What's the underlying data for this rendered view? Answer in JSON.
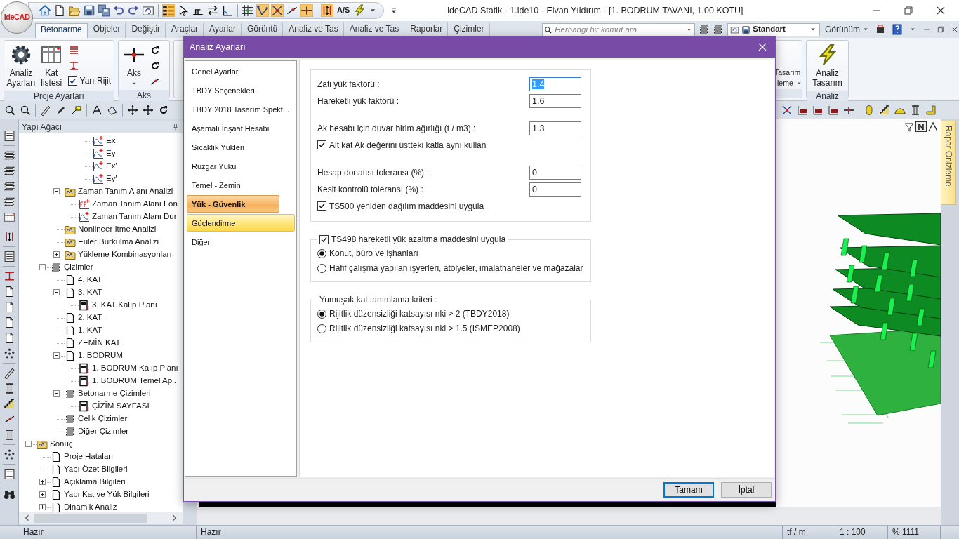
{
  "app": {
    "logo": "ideCAD",
    "title": "ideCAD Statik - 1.ide10 - Elvan Yıldırım - [1. BODRUM TAVANI,  1.00 KOTU]"
  },
  "quick_access": [
    {
      "kind": "tool",
      "on": false
    },
    {
      "kind": "tool",
      "on": false
    },
    {
      "kind": "tool",
      "on": false
    },
    {
      "kind": "tool",
      "on": false
    },
    {
      "kind": "tool",
      "on": false
    },
    {
      "kind": "tool",
      "on": false
    },
    {
      "kind": "tool",
      "on": false
    },
    {
      "kind": "tool",
      "on": false
    },
    {
      "kind": "tool",
      "on": true
    },
    {
      "kind": "tool",
      "on": false
    },
    {
      "kind": "tool",
      "on": false
    },
    {
      "kind": "tool",
      "on": false
    },
    {
      "kind": "tool",
      "on": false
    },
    {
      "kind": "tool",
      "on": false
    },
    {
      "kind": "tool",
      "on": true
    },
    {
      "kind": "tool",
      "on": true
    },
    {
      "kind": "tool",
      "on": false
    },
    {
      "kind": "tool",
      "on": true
    },
    {
      "kind": "tool",
      "on": true
    },
    {
      "kind": "text",
      "label": "A/S"
    },
    {
      "kind": "tool",
      "on": false
    },
    {
      "kind": "menu"
    }
  ],
  "ribbon_tabs": [
    {
      "label": "Betonarme",
      "selected": true
    },
    {
      "label": "Objeler",
      "selected": false
    },
    {
      "label": "Değiştir",
      "selected": false
    },
    {
      "label": "Araçlar",
      "selected": false
    },
    {
      "label": "Ayarlar",
      "selected": false
    },
    {
      "label": "Görüntü",
      "selected": false
    },
    {
      "label": "Analiz ve Tas",
      "selected": false
    },
    {
      "label": "Analiz ve Tas",
      "selected": false
    },
    {
      "label": "Raporlar",
      "selected": false
    },
    {
      "label": "Çizimler",
      "selected": false
    }
  ],
  "command_search": {
    "placeholder": "Herhangi bir komut ara"
  },
  "style_select": {
    "value": "Standart"
  },
  "view_menu": {
    "label": "Görünüm"
  },
  "ribbon": {
    "project_group": {
      "label": "Proje Ayarları",
      "settings_button": "Analiz Ayarları",
      "floors_button": "Kat listesi",
      "semi_rigid": {
        "label": "Yarı Rijit",
        "checked": true
      }
    },
    "axis_group": {
      "label": "Aks",
      "axis_button": "Aks"
    },
    "design_group": {
      "lines": [
        "Tasarım",
        "leme"
      ]
    },
    "analysis_group": {
      "label": "Analiz",
      "button": "Analiz Tasarım"
    }
  },
  "tree": {
    "title": "Yapı Ağacı",
    "nodes": [
      {
        "children": [
          {
            "children": [
              {
                "children": [
                  {
                    "children": [
                      {
                        "label": "Ex",
                        "kind": "chart"
                      },
                      {
                        "label": "Ey",
                        "kind": "chart"
                      },
                      {
                        "label": "Ex'",
                        "kind": "chart"
                      },
                      {
                        "label": "Ey'",
                        "kind": "chart"
                      }
                    ]
                  }
                ]
              },
              {
                "label": "Zaman Tanım Alanı Analizi",
                "kind": "folder",
                "expanded": true,
                "children": [
                  {
                    "label": "Zaman Tanım Alanı Fon",
                    "kind": "function"
                  },
                  {
                    "label": "Zaman Tanım Alanı Dur",
                    "kind": "chart"
                  }
                ]
              },
              {
                "label": "Nonlineer İtme Analizi",
                "kind": "folder"
              },
              {
                "label": "Euler Burkulma Analizi",
                "kind": "folder"
              },
              {
                "label": "Yükleme Kombinasyonları",
                "kind": "folder",
                "expanded": false
              }
            ]
          },
          {
            "label": "Çizimler",
            "kind": "stack",
            "expanded": true,
            "children": [
              {
                "label": "4. KAT",
                "kind": "page"
              },
              {
                "label": "3. KAT",
                "kind": "page",
                "expanded": true,
                "children": [
                  {
                    "label": "3. KAT Kalıp Planı",
                    "kind": "sheet"
                  }
                ]
              },
              {
                "label": "2. KAT",
                "kind": "page"
              },
              {
                "label": "1. KAT",
                "kind": "page"
              },
              {
                "label": "ZEMİN KAT",
                "kind": "page"
              },
              {
                "label": "1. BODRUM",
                "kind": "page",
                "expanded": true,
                "children": [
                  {
                    "label": "1. BODRUM Kalıp Planı",
                    "kind": "sheet"
                  },
                  {
                    "label": "1. BODRUM Temel Apl.",
                    "kind": "sheet"
                  }
                ]
              },
              {
                "label": "Betonarme Çizimleri",
                "kind": "stack",
                "expanded": true,
                "children": [
                  {
                    "label": "ÇİZİM SAYFASI",
                    "kind": "sheet"
                  }
                ]
              },
              {
                "label": "Çelik Çizimleri",
                "kind": "stack"
              },
              {
                "label": "Diğer Çizimler",
                "kind": "stack"
              }
            ]
          }
        ]
      },
      {
        "label": "Sonuç",
        "kind": "folder",
        "expanded": true,
        "children": [
          {
            "label": "Proje Hataları",
            "kind": "page"
          },
          {
            "label": "Yapı Özet Bilgileri",
            "kind": "page"
          },
          {
            "label": "Açıklama Bilgileri",
            "kind": "page",
            "expanded": false
          },
          {
            "label": "Yapı Kat ve Yük Bilgileri",
            "kind": "page",
            "expanded": false
          },
          {
            "label": "Dinamik Analiz",
            "kind": "page",
            "expanded": false
          }
        ]
      }
    ]
  },
  "viewport": {
    "north_button": "N"
  },
  "side_tab": "Rapor Önizleme",
  "dialog": {
    "title": "Analiz Ayarları",
    "nav": [
      {
        "label": "Genel Ayarlar",
        "selected": false,
        "hovered": false
      },
      {
        "label": "TBDY Seçenekleri",
        "selected": false,
        "hovered": false
      },
      {
        "label": "TBDY 2018 Tasarım Spekt...",
        "selected": false,
        "hovered": false
      },
      {
        "label": "Aşamalı İnşaat Hesabı",
        "selected": false,
        "hovered": false
      },
      {
        "label": "Sıcaklık Yükleri",
        "selected": false,
        "hovered": false
      },
      {
        "label": "Rüzgar Yükü",
        "selected": false,
        "hovered": false
      },
      {
        "label": "Temel - Zemin",
        "selected": false,
        "hovered": false
      },
      {
        "label": "Yük - Güvenlik",
        "selected": true,
        "hovered": false
      },
      {
        "label": "Güçlendirme",
        "selected": false,
        "hovered": true
      },
      {
        "label": "Diğer",
        "selected": false,
        "hovered": false
      }
    ],
    "groups": [
      {
        "blocks": [
          [
            {
              "kind": "field",
              "label": "Zati yük faktörü :",
              "value": "1.4",
              "focused": true
            },
            {
              "kind": "field",
              "label": "Hareketli yük faktörü :",
              "value": "1.6",
              "focused": false
            }
          ],
          [
            {
              "kind": "field",
              "label": "Ak hesabı için duvar birim ağırlığı (t / m3) :",
              "value": "1.3",
              "focused": false
            },
            {
              "kind": "checkbox",
              "label": "Alt kat  Ak değerini üstteki katla aynı kullan",
              "checked": true
            }
          ],
          [
            {
              "kind": "field",
              "label": "Hesap donatısı toleransı (%) :",
              "value": "0",
              "focused": false
            },
            {
              "kind": "field",
              "label": "Kesit kontrolü toleransı (%) :",
              "value": "0",
              "focused": false
            },
            {
              "kind": "checkbox",
              "label": "TS500 yeniden dağılım maddesini uygula",
              "checked": true
            }
          ]
        ]
      },
      {
        "legend": {
          "kind": "checkbox",
          "label": "TS498 hareketli yük azaltma maddesini uygula",
          "checked": true
        },
        "blocks": [
          [
            {
              "kind": "radio",
              "label": "Konut, büro ve işhanları",
              "selected": true
            },
            {
              "kind": "radio",
              "label": "Hafif çalışma yapılan işyerleri, atölyeler, imalathaneler ve mağazalar",
              "selected": false
            }
          ]
        ]
      },
      {
        "legend": {
          "kind": "text",
          "label": "Yumuşak kat tanımlama kriteri :"
        },
        "blocks": [
          [
            {
              "kind": "radio",
              "label": "Rijitlik düzensizliği katsayısı nki > 2 (TBDY2018)",
              "selected": true
            },
            {
              "kind": "radio",
              "label": "Rijitlik düzensizliği katsayısı nki > 1.5 (ISMEP2008)",
              "selected": false
            }
          ]
        ]
      }
    ],
    "buttons": [
      {
        "label": "Tamam",
        "default": true
      },
      {
        "label": "İptal",
        "default": false
      }
    ]
  },
  "status_bar": [
    "Hazır",
    "Hazır",
    "tf / m",
    "1 : 100",
    "% 1111"
  ]
}
